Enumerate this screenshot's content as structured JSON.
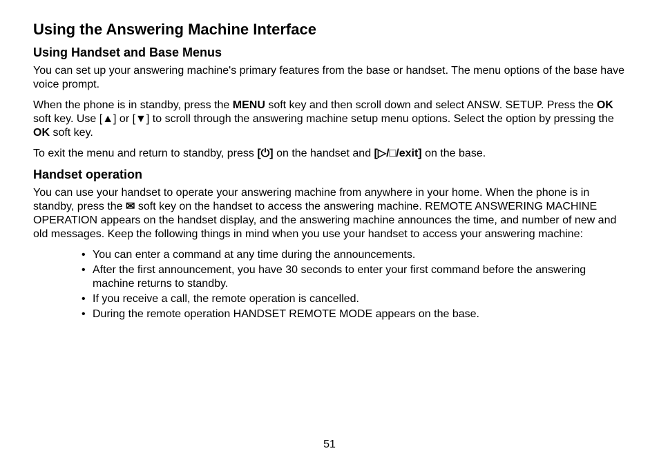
{
  "title": "Using the Answering Machine Interface",
  "section1": {
    "heading": "Using Handset and Base Menus",
    "p1": "You can set up your answering machine's primary features from the base or handset. The menu options of the base have voice prompt.",
    "p2_a": "When the phone is in standby, press the ",
    "p2_menu": "MENU",
    "p2_b": " soft key and then scroll down and select ANSW. SETUP. Press the ",
    "p2_ok1": "OK",
    "p2_c": " soft key. Use [",
    "p2_up": "▲",
    "p2_d": "] or [",
    "p2_down": "▼",
    "p2_e": "] to scroll through the answering machine setup menu options. Select the option by pressing the ",
    "p2_ok2": "OK",
    "p2_f": " soft key.",
    "p3_a": "To exit the menu and return to standby, press ",
    "p3_end": "[⏻]",
    "p3_b": " on the handset and ",
    "p3_exit": "[▷/□/exit]",
    "p3_c": " on the base."
  },
  "section2": {
    "heading": "Handset operation",
    "p1_a": "You can use your handset to operate your answering machine from anywhere in your home. When the phone is in standby, press the ",
    "p1_env": "✉",
    "p1_b": " soft key on the handset to access the answering machine. REMOTE ANSWERING MACHINE OPERATION appears on the handset display, and the answering machine announces the time, and number of new and old messages. Keep the following things in mind when you use your handset to access your answering machine:",
    "bullets": [
      "You can enter a command at any time during the announcements.",
      "After the first announcement, you have 30 seconds to enter your first command before the answering machine returns to standby.",
      "If you receive a call, the remote operation is cancelled.",
      "During the remote operation HANDSET REMOTE MODE appears on the base."
    ]
  },
  "pageNumber": "51"
}
